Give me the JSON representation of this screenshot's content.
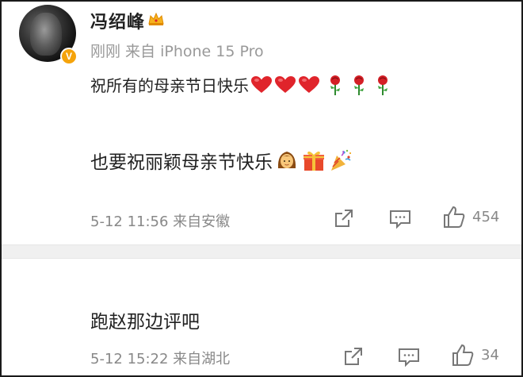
{
  "post": {
    "username": "冯绍峰",
    "meta": "刚刚 来自 iPhone 15 Pro",
    "line1": "祝所有的母亲节日快乐",
    "line2": "也要祝丽颖母亲节快乐",
    "timestamp": "5-12 11:56 来自安徽",
    "like_count": "454",
    "icons": {
      "verify": "verified-badge-icon",
      "crown": "crown-icon",
      "line1_emojis": [
        "heart-icon",
        "heart-icon",
        "heart-icon",
        "rose-icon",
        "rose-icon",
        "rose-icon"
      ],
      "line2_emojis": [
        "woman-icon",
        "gift-icon",
        "party-popper-icon"
      ],
      "actions": [
        "share-icon",
        "comment-icon",
        "like-icon"
      ]
    }
  },
  "reply": {
    "text": "跑赵那边评吧",
    "timestamp": "5-12 15:22 来自湖北",
    "like_count": "34"
  },
  "colors": {
    "verify_badge": "#f5a30b",
    "heart": "#e0242b",
    "meta_text": "#999999",
    "divider": "#f0f0f0"
  }
}
